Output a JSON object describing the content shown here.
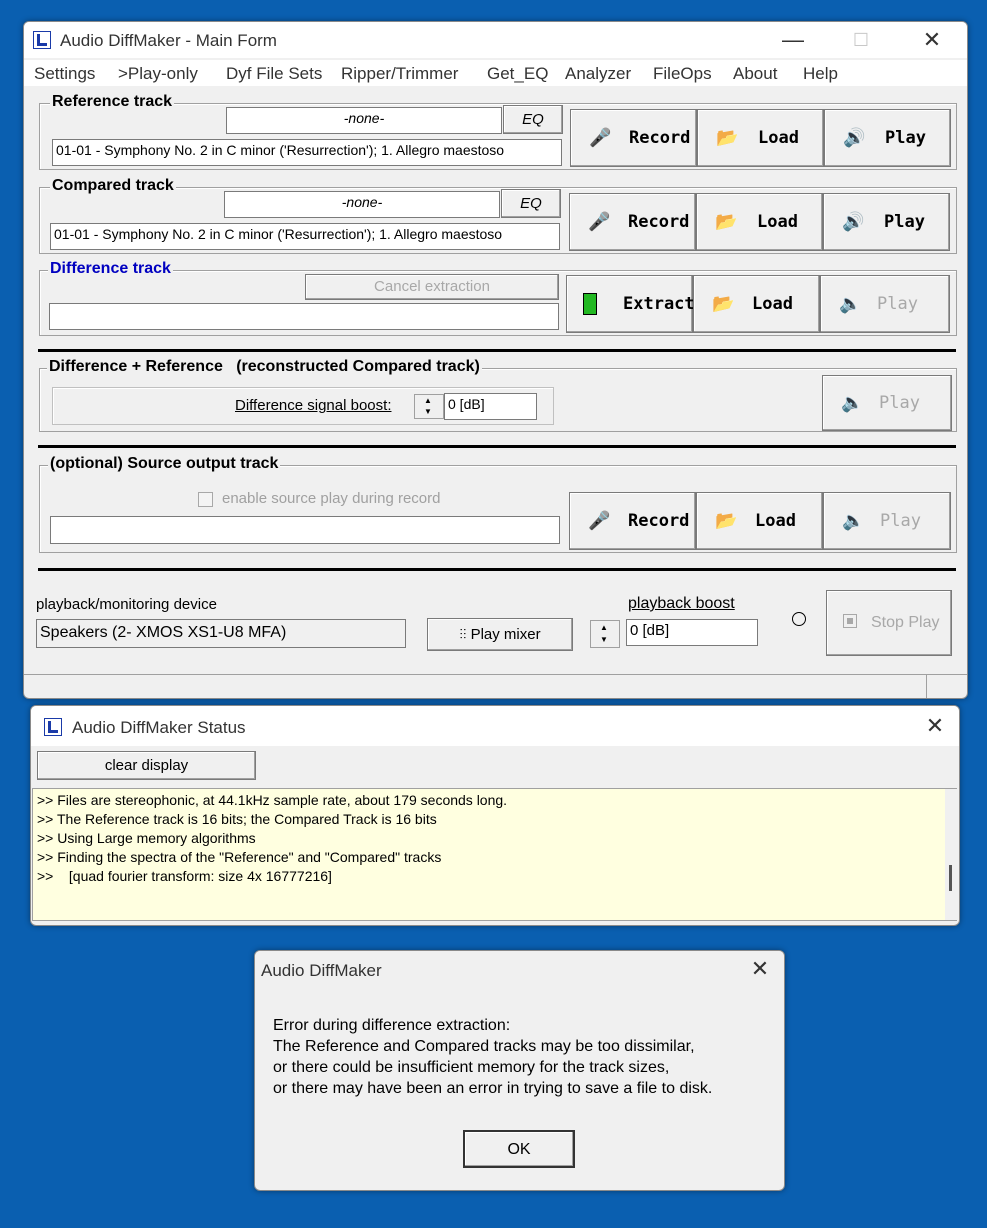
{
  "main_window": {
    "title": "Audio DiffMaker - Main Form",
    "menu": [
      "Settings",
      ">Play-only",
      "Dyf File Sets",
      "Ripper/Trimmer",
      "Get_EQ",
      "Analyzer",
      "FileOps",
      "About",
      "Help"
    ],
    "reference": {
      "title": "Reference track",
      "eq_value": "-none-",
      "eq_button": "EQ",
      "file": "01-01 - Symphony No. 2 in C minor ('Resurrection'); 1. Allegro maestoso",
      "record": "Record",
      "load": "Load",
      "play": "Play"
    },
    "compared": {
      "title": "Compared track",
      "eq_value": "-none-",
      "eq_button": "EQ",
      "file": "01-01 - Symphony No. 2 in C minor ('Resurrection'); 1. Allegro maestoso",
      "record": "Record",
      "load": "Load",
      "play": "Play"
    },
    "difference": {
      "title": "Difference track",
      "cancel": "Cancel extraction",
      "file": "",
      "extract": "Extract",
      "load": "Load",
      "play": "Play"
    },
    "reconstructed": {
      "title": "Difference + Reference   (reconstructed Compared track)",
      "boost_label": "Difference signal boost:",
      "boost_value": "0 [dB]",
      "play": "Play"
    },
    "source": {
      "title": "(optional) Source output track",
      "checkbox_label": "enable source play during record",
      "file": "",
      "record": "Record",
      "load": "Load",
      "play": "Play"
    },
    "device": {
      "label": "playback/monitoring device",
      "value": "Speakers (2- XMOS XS1-U8 MFA)",
      "mixer": "Play mixer",
      "boost_label": "playback boost",
      "boost_value": "0 [dB]",
      "stop": "Stop Play"
    }
  },
  "status_window": {
    "title": "Audio DiffMaker Status",
    "clear": "clear display",
    "lines": [
      ">> Files are stereophonic, at 44.1kHz sample rate, about 179 seconds long.",
      ">> The Reference track is 16 bits; the Compared Track is 16 bits",
      ">> Using Large memory algorithms",
      ">> Finding the spectra of the \"Reference\" and \"Compared\" tracks",
      ">>    [quad fourier transform: size 4x 16777216]"
    ]
  },
  "dialog": {
    "title": "Audio DiffMaker",
    "lines": [
      "Error during difference extraction:",
      "The Reference and Compared tracks may be too dissimilar,",
      "or there could be insufficient memory for the track sizes,",
      "or there may have been an error in trying to save a file to disk."
    ],
    "ok": "OK"
  },
  "colors": {
    "desktop": "#0a5fb0",
    "difference_title": "#0000c0",
    "status_bg": "#ffffe0"
  }
}
